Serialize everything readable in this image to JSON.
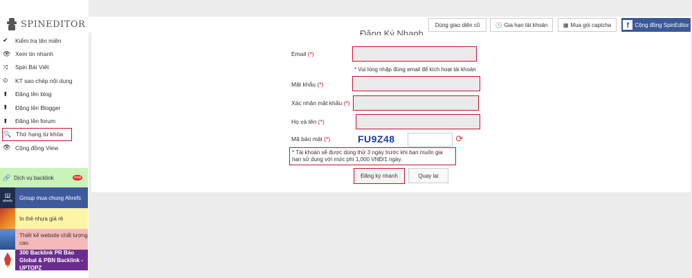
{
  "logo": {
    "text": "SPINEDITOR"
  },
  "sidebar": {
    "items": [
      {
        "label": "Kiểm tra tên miền",
        "icon": "check-icon"
      },
      {
        "label": "Xem tin nhanh",
        "icon": "eye-icon"
      },
      {
        "label": "Spin Bài Viết",
        "icon": "shuffle-icon"
      },
      {
        "label": "KT sao chép nội dung",
        "icon": "copy-check-icon"
      },
      {
        "label": "Đăng lên blog",
        "icon": "upload-icon"
      },
      {
        "label": "Đăng lên Blogger",
        "icon": "upload-icon"
      },
      {
        "label": "Đăng lên forum",
        "icon": "upload-icon"
      },
      {
        "label": "Thứ hạng từ khóa",
        "icon": "search-icon"
      },
      {
        "label": "Cộng đồng View",
        "icon": "eye-icon"
      }
    ],
    "promos": [
      {
        "label": "Dịch vụ backlink",
        "badge": "new"
      },
      {
        "label": "Group mua chung Ahrefs",
        "thumb_text": "ahrefs"
      },
      {
        "label": "In thẻ nhựa giá rẻ"
      },
      {
        "label": "Thiết kế website chất lượng cao"
      },
      {
        "label": "300 Backlink PR Báo Global & PBN Backlink - UPTOPZ"
      }
    ]
  },
  "topbar": {
    "old_ui": "Dùng giao diện cũ",
    "renew": "Gia hạn tài khoản",
    "captcha": "Mua gói captcha",
    "community": "Cộng đồng SpinEditor"
  },
  "form": {
    "title": "Đăng Ký Nhanh",
    "email_label": "Email",
    "email_hint": "* Vui lòng nhập đúng email để kích hoạt tài khoản",
    "password_label": "Mật khẩu",
    "confirm_label": "Xác nhận mật khẩu",
    "name_label": "Họ và tên",
    "captcha_label": "Mã bảo mật",
    "captcha_code": "FU9Z48",
    "required_mark": "(*)",
    "notice": "* Tài khoản sẽ được dùng thử 3 ngày trước khi bạn muốn gia hạn sử dụng với mức phí 1,000 VNĐ/1 ngày.",
    "submit": "Đăng ký nhanh",
    "back": "Quay lại"
  },
  "colors": {
    "highlight_red": "#c8102e",
    "captcha_blue": "#1a3aa5",
    "facebook": "#3b5998"
  }
}
